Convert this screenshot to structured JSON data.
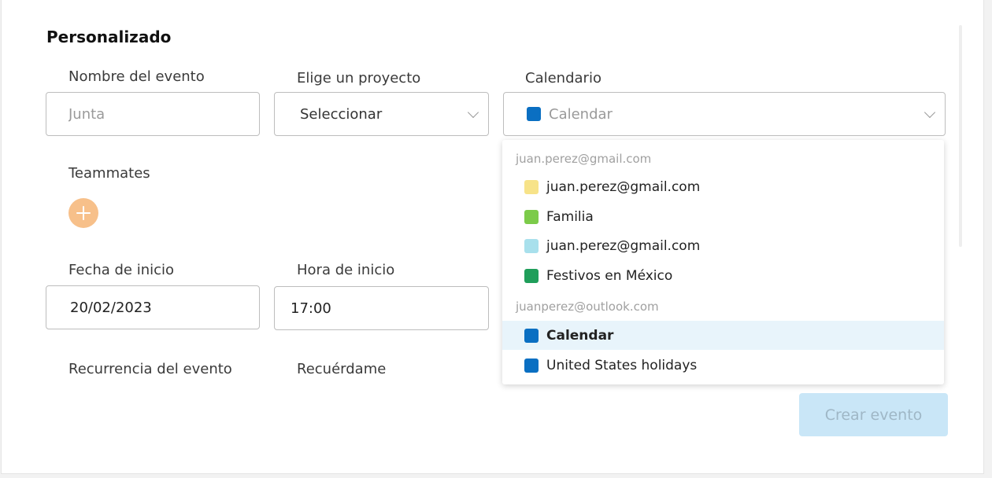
{
  "form": {
    "title": "Personalizado",
    "event_name": {
      "label": "Nombre del evento",
      "placeholder": "Junta",
      "value": ""
    },
    "project": {
      "label": "Elige un proyecto",
      "value": "Seleccionar"
    },
    "calendar": {
      "label": "Calendario",
      "value": "Calendar",
      "color": "#0a6fc2"
    },
    "teammates": {
      "label": "Teammates"
    },
    "start_date": {
      "label": "Fecha de inicio",
      "value": "20/02/2023"
    },
    "start_time": {
      "label": "Hora de inicio",
      "value": "17:00"
    },
    "recurrence": {
      "label": "Recurrencia del evento"
    },
    "remind": {
      "label": "Recuérdame"
    },
    "create_button": "Crear evento"
  },
  "calendar_dropdown": {
    "groups": [
      {
        "account": "juan.perez@gmail.com",
        "items": [
          {
            "label": "juan.perez@gmail.com",
            "color": "#f7e389"
          },
          {
            "label": "Familia",
            "color": "#7ccb4a"
          },
          {
            "label": "juan.perez@gmail.com",
            "color": "#a8e0ec"
          },
          {
            "label": "Festivos en México",
            "color": "#1f9e5a"
          }
        ]
      },
      {
        "account": "juanperez@outlook.com",
        "items": [
          {
            "label": "Calendar",
            "color": "#0a6fc2",
            "selected": true
          },
          {
            "label": "United States holidays",
            "color": "#0a6fc2"
          }
        ]
      }
    ]
  },
  "colors": {
    "add_button": "#f7c08a",
    "create_button_bg": "#c9e6f7",
    "selected_row_bg": "#e8f4fb"
  }
}
